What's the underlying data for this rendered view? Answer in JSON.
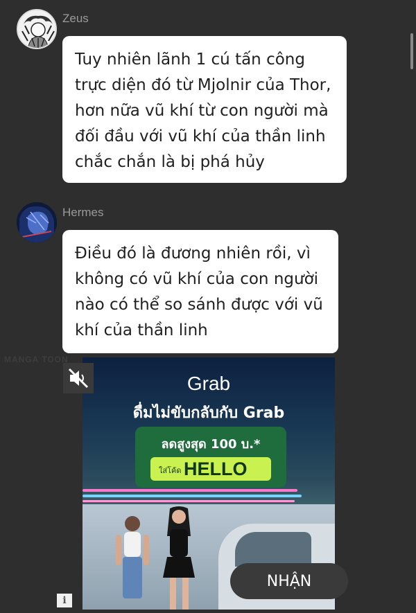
{
  "messages": [
    {
      "sender": "Zeus",
      "avatar_icon": "zeus-avatar-icon",
      "text": "Tuy nhiên lãnh 1 cú tấn công\ntrực diện đó từ Mjolnir của Thor,\nhơn nữa vũ khí từ con người mà\nđối đầu với vũ khí của thần linh\nchắc chắn là bị phá hủy"
    },
    {
      "sender": "Hermes",
      "avatar_icon": "hermes-avatar-icon",
      "text": "Điều đó là đương nhiên rồi, vì\nkhông có vũ khí của con người\nnào có thể so sánh được với vũ\nkhí của thần linh"
    }
  ],
  "watermark": "MANGA TOON",
  "ad": {
    "logo": "Grab",
    "headline": "ดื่มไม่ขับกลับกับ Grab",
    "promo_line": "ลดสูงสุด 100 บ.*",
    "code_prefix": "ใส่โค้ด",
    "code": "HELLO",
    "cta_label": "NHẬN",
    "mute_icon": "speaker-muted-icon",
    "info_icon": "info-icon",
    "colors": {
      "promo_green": "#1f6d3c",
      "code_lime": "#c9f250",
      "neon_pink": "#ff7acb",
      "neon_blue": "#78d4ff"
    }
  },
  "theme": {
    "background": "#2e2e2e",
    "bubble": "#ffffff",
    "sender_text": "#9a9a9a"
  }
}
